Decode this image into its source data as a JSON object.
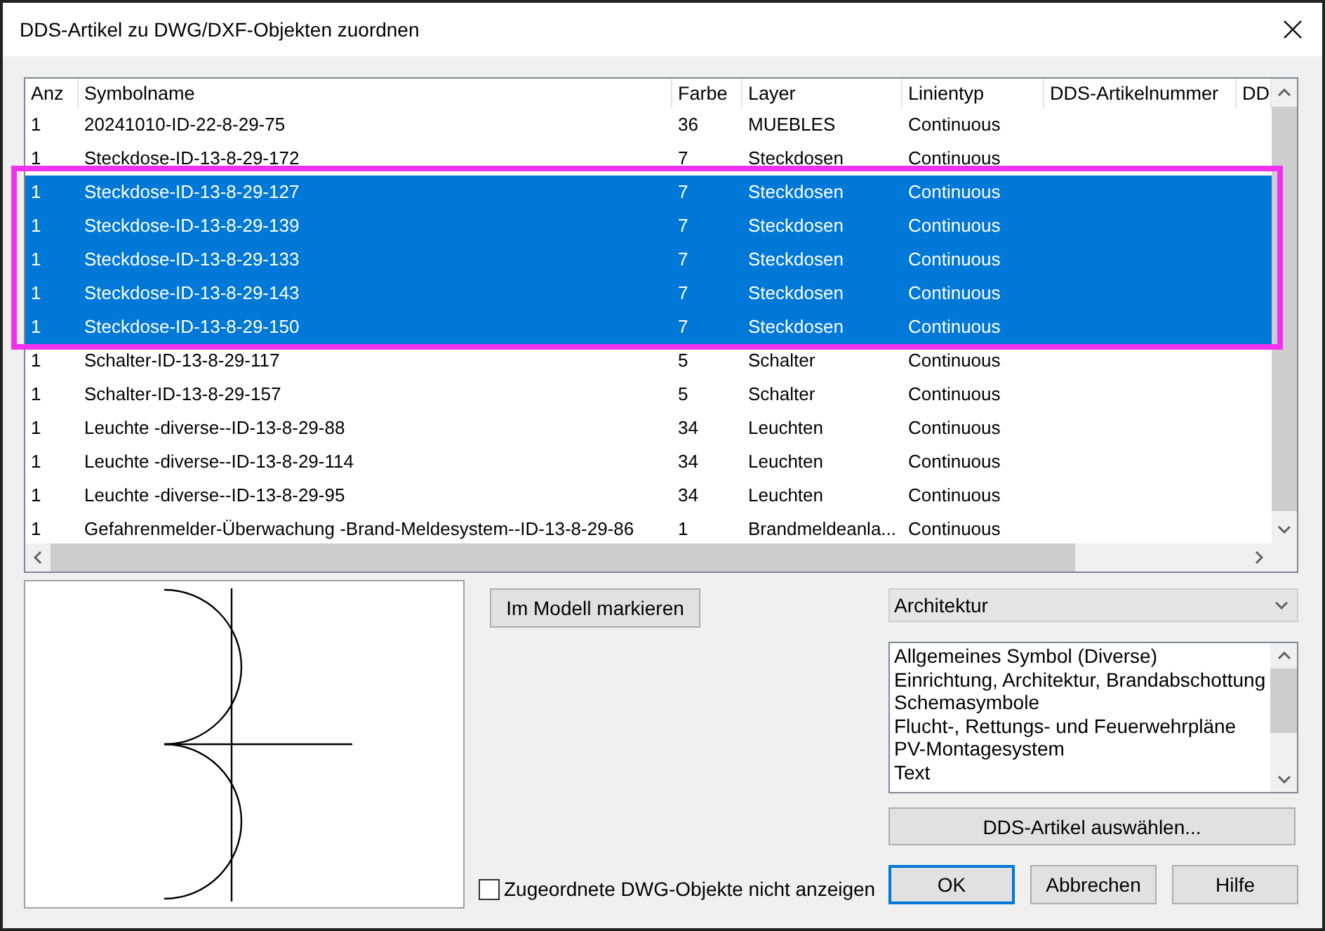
{
  "window": {
    "title": "DDS-Artikel zu DWG/DXF-Objekten zuordnen"
  },
  "table": {
    "columns": [
      "Anz",
      "Symbolname",
      "Farbe",
      "Layer",
      "Linientyp",
      "DDS-Artikelnummer",
      "DD"
    ],
    "rows": [
      {
        "cells": [
          "1",
          "20241010-ID-22-8-29-75",
          "36",
          "MUEBLES",
          "Continuous"
        ],
        "selected": false
      },
      {
        "cells": [
          "1",
          "Steckdose-ID-13-8-29-172",
          "7",
          "Steckdosen",
          "Continuous"
        ],
        "selected": false
      },
      {
        "cells": [
          "1",
          "Steckdose-ID-13-8-29-127",
          "7",
          "Steckdosen",
          "Continuous"
        ],
        "selected": true
      },
      {
        "cells": [
          "1",
          "Steckdose-ID-13-8-29-139",
          "7",
          "Steckdosen",
          "Continuous"
        ],
        "selected": true
      },
      {
        "cells": [
          "1",
          "Steckdose-ID-13-8-29-133",
          "7",
          "Steckdosen",
          "Continuous"
        ],
        "selected": true
      },
      {
        "cells": [
          "1",
          "Steckdose-ID-13-8-29-143",
          "7",
          "Steckdosen",
          "Continuous"
        ],
        "selected": true
      },
      {
        "cells": [
          "1",
          "Steckdose-ID-13-8-29-150",
          "7",
          "Steckdosen",
          "Continuous"
        ],
        "selected": true
      },
      {
        "cells": [
          "1",
          "Schalter-ID-13-8-29-117",
          "5",
          "Schalter",
          "Continuous"
        ],
        "selected": false
      },
      {
        "cells": [
          "1",
          "Schalter-ID-13-8-29-157",
          "5",
          "Schalter",
          "Continuous"
        ],
        "selected": false
      },
      {
        "cells": [
          "1",
          "Leuchte -diverse--ID-13-8-29-88",
          "34",
          "Leuchten",
          "Continuous"
        ],
        "selected": false
      },
      {
        "cells": [
          "1",
          "Leuchte -diverse--ID-13-8-29-114",
          "34",
          "Leuchten",
          "Continuous"
        ],
        "selected": false
      },
      {
        "cells": [
          "1",
          "Leuchte -diverse--ID-13-8-29-95",
          "34",
          "Leuchten",
          "Continuous"
        ],
        "selected": false
      },
      {
        "cells": [
          "1",
          "Gefahrenmelder-Überwachung -Brand-Meldesystem--ID-13-8-29-86",
          "1",
          "Brandmeldeanla...",
          "Continuous"
        ],
        "selected": false
      }
    ]
  },
  "mark_button": "Im Modell markieren",
  "category_dropdown": {
    "value": "Architektur"
  },
  "category_list": [
    "Allgemeines Symbol (Diverse)",
    "Einrichtung, Architektur, Brandabschottung",
    "Schemasymbole",
    "Flucht-, Rettungs- und Feuerwehrpläne",
    "PV-Montagesystem",
    "Text"
  ],
  "select_button": "DDS-Artikel auswählen...",
  "hide_checkbox": {
    "label": "Zugeordnete DWG-Objekte nicht anzeigen",
    "checked": false
  },
  "buttons": [
    {
      "label": "OK",
      "default": true
    },
    {
      "label": "Abbrechen",
      "default": false
    },
    {
      "label": "Hilfe",
      "default": false
    }
  ]
}
